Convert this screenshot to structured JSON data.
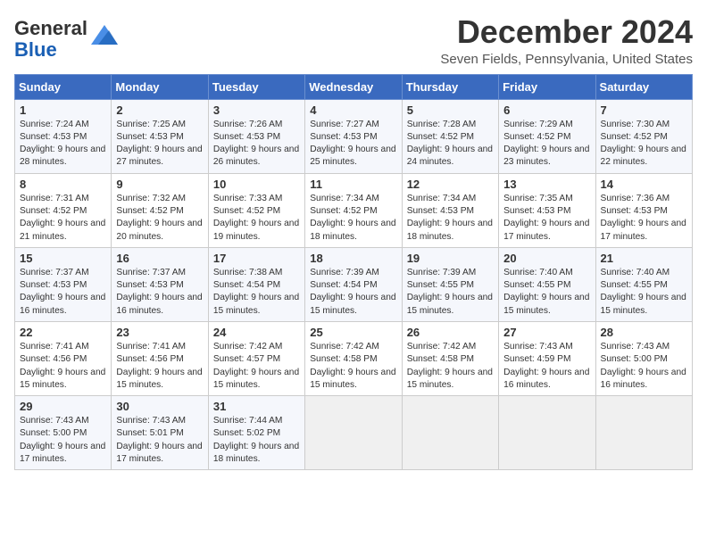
{
  "header": {
    "logo_line1": "General",
    "logo_line2": "Blue",
    "month_title": "December 2024",
    "location": "Seven Fields, Pennsylvania, United States"
  },
  "days_of_week": [
    "Sunday",
    "Monday",
    "Tuesday",
    "Wednesday",
    "Thursday",
    "Friday",
    "Saturday"
  ],
  "weeks": [
    [
      {
        "day": "1",
        "sunrise": "7:24 AM",
        "sunset": "4:53 PM",
        "daylight": "9 hours and 28 minutes."
      },
      {
        "day": "2",
        "sunrise": "7:25 AM",
        "sunset": "4:53 PM",
        "daylight": "9 hours and 27 minutes."
      },
      {
        "day": "3",
        "sunrise": "7:26 AM",
        "sunset": "4:53 PM",
        "daylight": "9 hours and 26 minutes."
      },
      {
        "day": "4",
        "sunrise": "7:27 AM",
        "sunset": "4:53 PM",
        "daylight": "9 hours and 25 minutes."
      },
      {
        "day": "5",
        "sunrise": "7:28 AM",
        "sunset": "4:52 PM",
        "daylight": "9 hours and 24 minutes."
      },
      {
        "day": "6",
        "sunrise": "7:29 AM",
        "sunset": "4:52 PM",
        "daylight": "9 hours and 23 minutes."
      },
      {
        "day": "7",
        "sunrise": "7:30 AM",
        "sunset": "4:52 PM",
        "daylight": "9 hours and 22 minutes."
      }
    ],
    [
      {
        "day": "8",
        "sunrise": "7:31 AM",
        "sunset": "4:52 PM",
        "daylight": "9 hours and 21 minutes."
      },
      {
        "day": "9",
        "sunrise": "7:32 AM",
        "sunset": "4:52 PM",
        "daylight": "9 hours and 20 minutes."
      },
      {
        "day": "10",
        "sunrise": "7:33 AM",
        "sunset": "4:52 PM",
        "daylight": "9 hours and 19 minutes."
      },
      {
        "day": "11",
        "sunrise": "7:34 AM",
        "sunset": "4:52 PM",
        "daylight": "9 hours and 18 minutes."
      },
      {
        "day": "12",
        "sunrise": "7:34 AM",
        "sunset": "4:53 PM",
        "daylight": "9 hours and 18 minutes."
      },
      {
        "day": "13",
        "sunrise": "7:35 AM",
        "sunset": "4:53 PM",
        "daylight": "9 hours and 17 minutes."
      },
      {
        "day": "14",
        "sunrise": "7:36 AM",
        "sunset": "4:53 PM",
        "daylight": "9 hours and 17 minutes."
      }
    ],
    [
      {
        "day": "15",
        "sunrise": "7:37 AM",
        "sunset": "4:53 PM",
        "daylight": "9 hours and 16 minutes."
      },
      {
        "day": "16",
        "sunrise": "7:37 AM",
        "sunset": "4:53 PM",
        "daylight": "9 hours and 16 minutes."
      },
      {
        "day": "17",
        "sunrise": "7:38 AM",
        "sunset": "4:54 PM",
        "daylight": "9 hours and 15 minutes."
      },
      {
        "day": "18",
        "sunrise": "7:39 AM",
        "sunset": "4:54 PM",
        "daylight": "9 hours and 15 minutes."
      },
      {
        "day": "19",
        "sunrise": "7:39 AM",
        "sunset": "4:55 PM",
        "daylight": "9 hours and 15 minutes."
      },
      {
        "day": "20",
        "sunrise": "7:40 AM",
        "sunset": "4:55 PM",
        "daylight": "9 hours and 15 minutes."
      },
      {
        "day": "21",
        "sunrise": "7:40 AM",
        "sunset": "4:55 PM",
        "daylight": "9 hours and 15 minutes."
      }
    ],
    [
      {
        "day": "22",
        "sunrise": "7:41 AM",
        "sunset": "4:56 PM",
        "daylight": "9 hours and 15 minutes."
      },
      {
        "day": "23",
        "sunrise": "7:41 AM",
        "sunset": "4:56 PM",
        "daylight": "9 hours and 15 minutes."
      },
      {
        "day": "24",
        "sunrise": "7:42 AM",
        "sunset": "4:57 PM",
        "daylight": "9 hours and 15 minutes."
      },
      {
        "day": "25",
        "sunrise": "7:42 AM",
        "sunset": "4:58 PM",
        "daylight": "9 hours and 15 minutes."
      },
      {
        "day": "26",
        "sunrise": "7:42 AM",
        "sunset": "4:58 PM",
        "daylight": "9 hours and 15 minutes."
      },
      {
        "day": "27",
        "sunrise": "7:43 AM",
        "sunset": "4:59 PM",
        "daylight": "9 hours and 16 minutes."
      },
      {
        "day": "28",
        "sunrise": "7:43 AM",
        "sunset": "5:00 PM",
        "daylight": "9 hours and 16 minutes."
      }
    ],
    [
      {
        "day": "29",
        "sunrise": "7:43 AM",
        "sunset": "5:00 PM",
        "daylight": "9 hours and 17 minutes."
      },
      {
        "day": "30",
        "sunrise": "7:43 AM",
        "sunset": "5:01 PM",
        "daylight": "9 hours and 17 minutes."
      },
      {
        "day": "31",
        "sunrise": "7:44 AM",
        "sunset": "5:02 PM",
        "daylight": "9 hours and 18 minutes."
      },
      null,
      null,
      null,
      null
    ]
  ],
  "labels": {
    "sunrise_label": "Sunrise:",
    "sunset_label": "Sunset:",
    "daylight_label": "Daylight:"
  }
}
